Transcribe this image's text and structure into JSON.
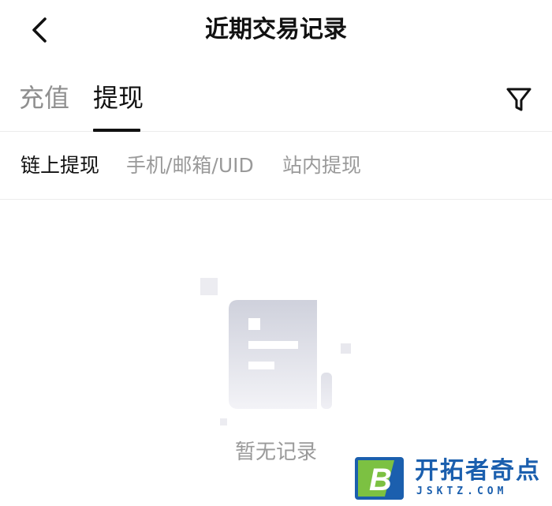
{
  "header": {
    "title": "近期交易记录",
    "back_icon": "chevron-left-icon"
  },
  "main_tabs": [
    {
      "label": "充值",
      "active": false
    },
    {
      "label": "提现",
      "active": true
    }
  ],
  "filter_icon": "funnel-filter-icon",
  "sub_tabs": [
    {
      "label": "链上提现",
      "active": true
    },
    {
      "label": "手机/邮箱/UID",
      "active": false
    },
    {
      "label": "站内提现",
      "active": false
    }
  ],
  "empty_state": {
    "text": "暂无记录",
    "icon": "empty-document-icon"
  },
  "watermark": {
    "logo_letter": "B",
    "name": "开拓者奇点",
    "url": "JSKTZ.COM"
  },
  "colors": {
    "primary_text": "#111111",
    "muted_text": "#9a9a9a",
    "divider": "#ececec",
    "watermark_blue": "#1b5fae",
    "watermark_green": "#7cc142"
  }
}
